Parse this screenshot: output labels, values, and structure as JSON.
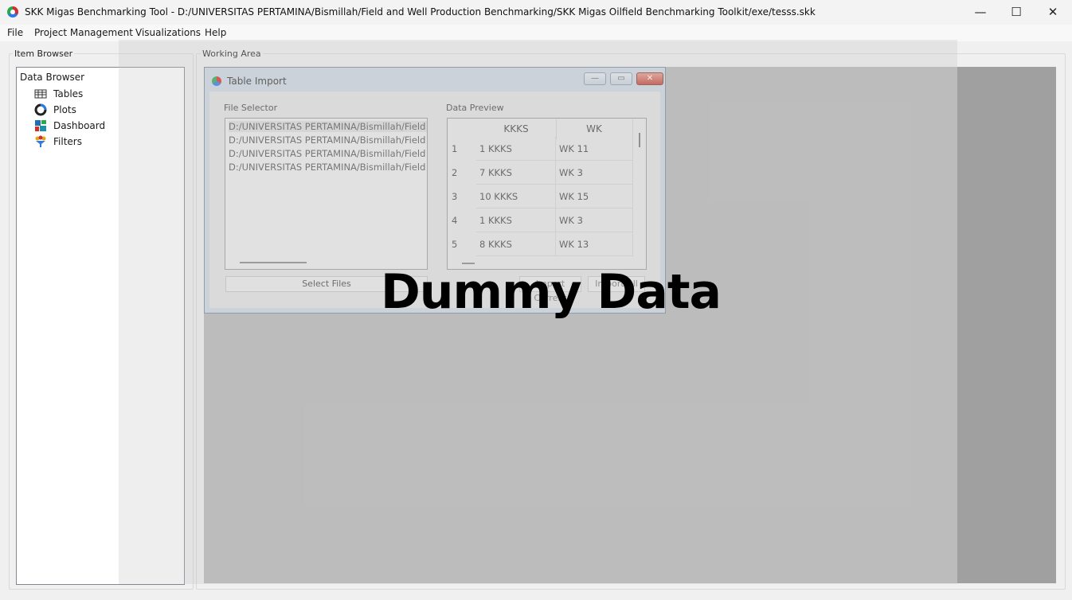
{
  "window": {
    "title": "SKK Migas Benchmarking Tool - D:/UNIVERSITAS PERTAMINA/Bismillah/Field and Well Production Benchmarking/SKK Migas Oilfield Benchmarking Toolkit/exe/tesss.skk",
    "minimize": "—",
    "maximize": "☐",
    "close": "✕"
  },
  "menu": [
    "File",
    "Project Management",
    "Visualizations",
    "Help"
  ],
  "item_browser": {
    "label": "Item Browser",
    "root": "Data Browser",
    "items": [
      {
        "label": "Tables",
        "icon": "table-icon"
      },
      {
        "label": "Plots",
        "icon": "plot-icon"
      },
      {
        "label": "Dashboard",
        "icon": "dashboard-icon"
      },
      {
        "label": "Filters",
        "icon": "filter-icon"
      }
    ]
  },
  "working_area": {
    "label": "Working Area"
  },
  "dialog": {
    "title": "Table Import",
    "file_selector_label": "File Selector",
    "files": [
      "D:/UNIVERSITAS PERTAMINA/Bismillah/Field an",
      "D:/UNIVERSITAS PERTAMINA/Bismillah/Field an",
      "D:/UNIVERSITAS PERTAMINA/Bismillah/Field an",
      "D:/UNIVERSITAS PERTAMINA/Bismillah/Field an"
    ],
    "select_files": "Select Files",
    "data_preview_label": "Data Preview",
    "columns": [
      "KKKS",
      "WK"
    ],
    "rows": [
      {
        "n": "1",
        "kkks": "1 KKKS",
        "wk": "WK 11"
      },
      {
        "n": "2",
        "kkks": "7 KKKS",
        "wk": "WK 3"
      },
      {
        "n": "3",
        "kkks": "10 KKKS",
        "wk": "WK 15"
      },
      {
        "n": "4",
        "kkks": "1 KKKS",
        "wk": "WK 3"
      },
      {
        "n": "5",
        "kkks": "8 KKKS",
        "wk": "WK 13"
      }
    ],
    "import_current": "Import Current",
    "import_all": "Import All"
  },
  "watermark": "Dummy Data"
}
